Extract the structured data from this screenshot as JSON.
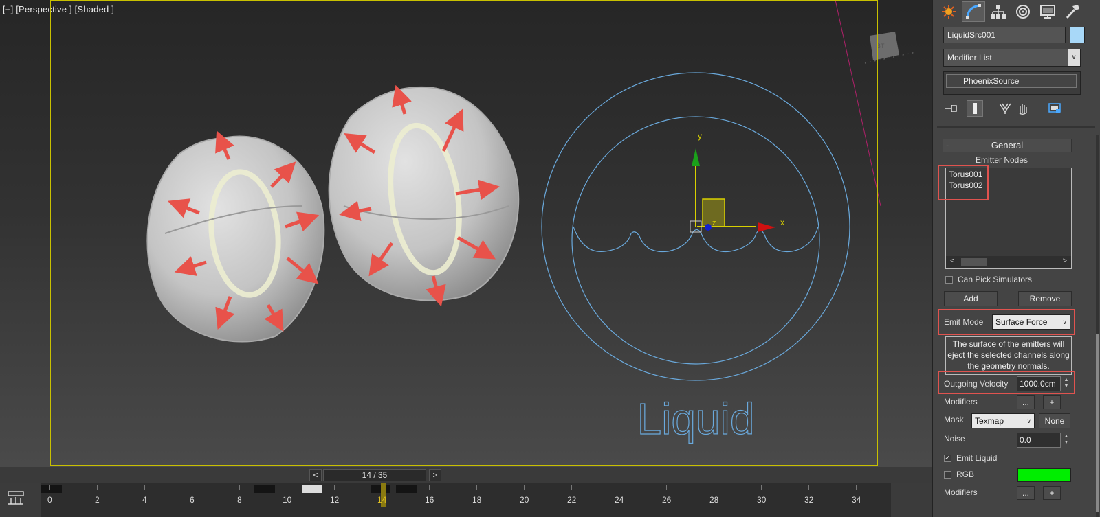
{
  "viewport": {
    "label": "[+] [Perspective ] [Shaded ]",
    "scene_text": "Liquid",
    "axis": {
      "x": "x",
      "y": "y",
      "z": "z"
    }
  },
  "timeline": {
    "prev_label": "<",
    "next_label": ">",
    "frame_readout": "14 / 35",
    "current_frame": 14,
    "total_frames": 35,
    "ticks": [
      "0",
      "2",
      "4",
      "6",
      "8",
      "10",
      "12",
      "14",
      "16",
      "18",
      "20",
      "22",
      "24",
      "26",
      "28",
      "30",
      "32",
      "34"
    ]
  },
  "command_panel": {
    "tabs": [
      "create-tab",
      "modify-tab",
      "hierarchy-tab",
      "motion-tab",
      "display-tab",
      "utilities-tab"
    ],
    "object_name": "LiquidSrc001",
    "object_color": "#a8d8f8",
    "modifier_list": "Modifier List",
    "stack_item": "PhoenixSource",
    "general": {
      "title": "General",
      "collapse": "-",
      "emitter_nodes_label": "Emitter Nodes",
      "emitter_nodes": [
        "Torus001",
        "Torus002"
      ],
      "scroll_left": "<",
      "scroll_right": ">",
      "can_pick_simulators": "Can Pick Simulators",
      "add_label": "Add",
      "remove_label": "Remove",
      "emit_mode_label": "Emit Mode",
      "emit_mode_value": "Surface Force",
      "emit_mode_desc": "The surface of the emitters will eject the selected channels along the geometry normals.",
      "outgoing_velocity_label": "Outgoing Velocity",
      "outgoing_velocity_value": "1000.0cm",
      "modifiers_label": "Modifiers",
      "dots_label": "...",
      "plus_label": "+",
      "mask_label": "Mask",
      "mask_value": "Texmap",
      "mask_none": "None",
      "noise_label": "Noise",
      "noise_value": "0.0",
      "emit_liquid_label": "Emit Liquid",
      "emit_liquid_checked": true,
      "rgb_label": "RGB",
      "rgb_checked": false,
      "rgb_color": "#00ee00",
      "modifiers2_label": "Modifiers"
    }
  },
  "colors": {
    "highlight": "#e0534f",
    "arrow": "#e8524a",
    "wire": "#6aa9dc",
    "frame": "#c8c000"
  }
}
